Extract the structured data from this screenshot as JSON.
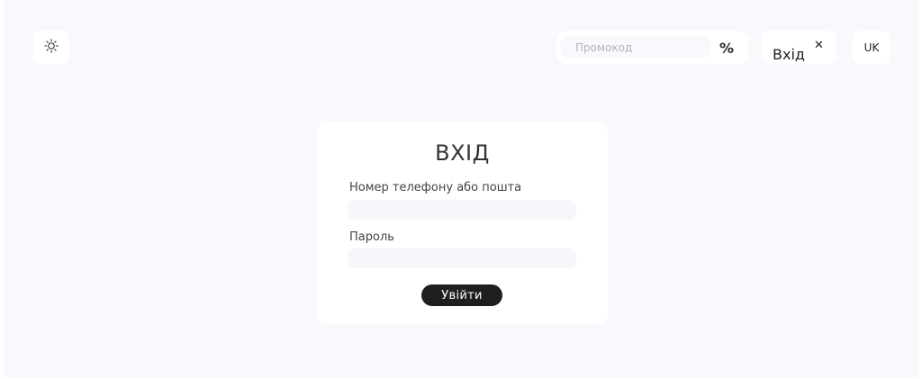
{
  "header": {
    "theme_toggle_icon": "sun-icon",
    "promo": {
      "placeholder": "Промокод",
      "value": "",
      "apply_icon": "percent-icon",
      "apply_symbol": "%"
    },
    "login_tab": {
      "label": "Вхід",
      "close_symbol": "✕"
    },
    "language": "UK"
  },
  "login_form": {
    "title": "ВХІД",
    "login_label": "Номер телефону або пошта",
    "login_value": "",
    "password_label": "Пароль",
    "password_value": "",
    "submit_label": "Увійти"
  },
  "colors": {
    "page_background": "#f8f9fc",
    "card_background": "#ffffff",
    "button_dark": "#1f1f1f"
  }
}
